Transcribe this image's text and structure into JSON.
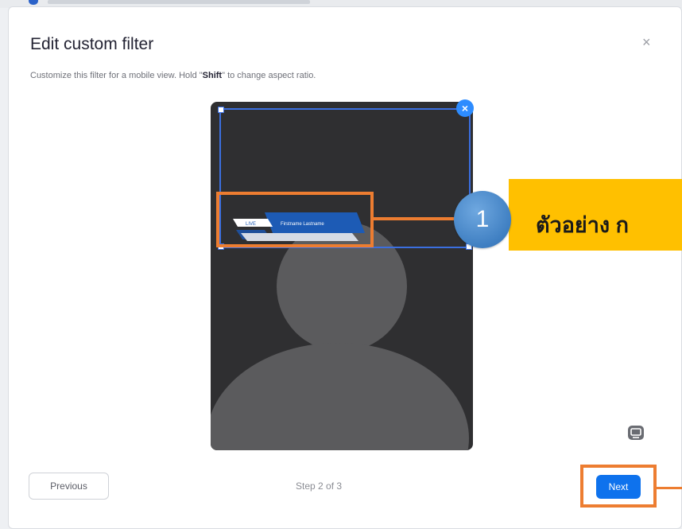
{
  "dialog": {
    "title": "Edit custom filter",
    "close_glyph": "×",
    "subtitle_pre": "Customize this filter for a mobile view. Hold \"",
    "subtitle_key": "Shift",
    "subtitle_post": "\" to change aspect ratio."
  },
  "preview": {
    "banner_tag": "LIVE",
    "banner_text": "Firstname Lastname",
    "remove_glyph": "×"
  },
  "annotation": {
    "number": "1",
    "label": "ตัวอย่าง ก"
  },
  "footer": {
    "previous_label": "Previous",
    "step_text": "Step 2 of 3",
    "next_label": "Next"
  },
  "colors": {
    "accent_blue": "#0e72ed",
    "callout_orange": "#ed7d31",
    "label_yellow": "#ffc000",
    "circle_blue": "#4a86c8"
  }
}
